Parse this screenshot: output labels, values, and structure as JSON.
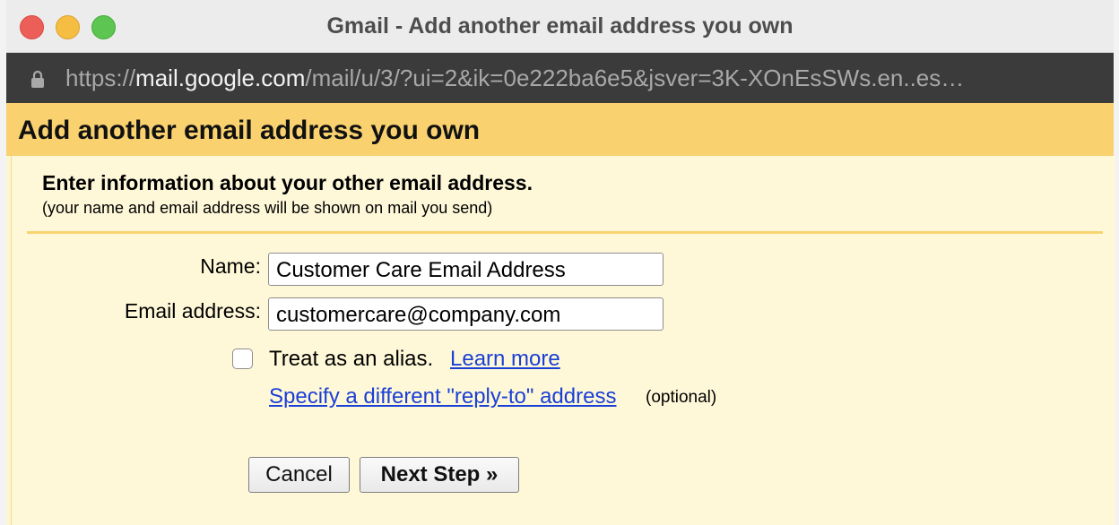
{
  "window": {
    "title": "Gmail - Add another email address you own"
  },
  "address_bar": {
    "scheme": "https://",
    "host": "mail.google.com",
    "path": "/mail/u/3/?ui=2&ik=0e222ba6e5&jsver=3K-XOnEsSWs.en..es…"
  },
  "dialog": {
    "title": "Add another email address you own",
    "intro_title": "Enter information about your other email address.",
    "intro_subtitle": "(your name and email address will be shown on mail you send)",
    "fields": {
      "name_label": "Name:",
      "name_value": "Customer Care Email Address",
      "email_label": "Email address:",
      "email_value": "customercare@company.com"
    },
    "alias": {
      "label": "Treat as an alias.",
      "learn_more": "Learn more",
      "checked": false
    },
    "reply_to": {
      "link": "Specify a different \"reply-to\" address",
      "note": "(optional)"
    },
    "buttons": {
      "cancel": "Cancel",
      "next": "Next Step »"
    }
  },
  "colors": {
    "header_bg": "#f9d16f",
    "body_bg": "#fef8d8",
    "divider": "#f7d46f",
    "link": "#1a3fd6",
    "url_bar_bg": "#3b3b3b"
  }
}
